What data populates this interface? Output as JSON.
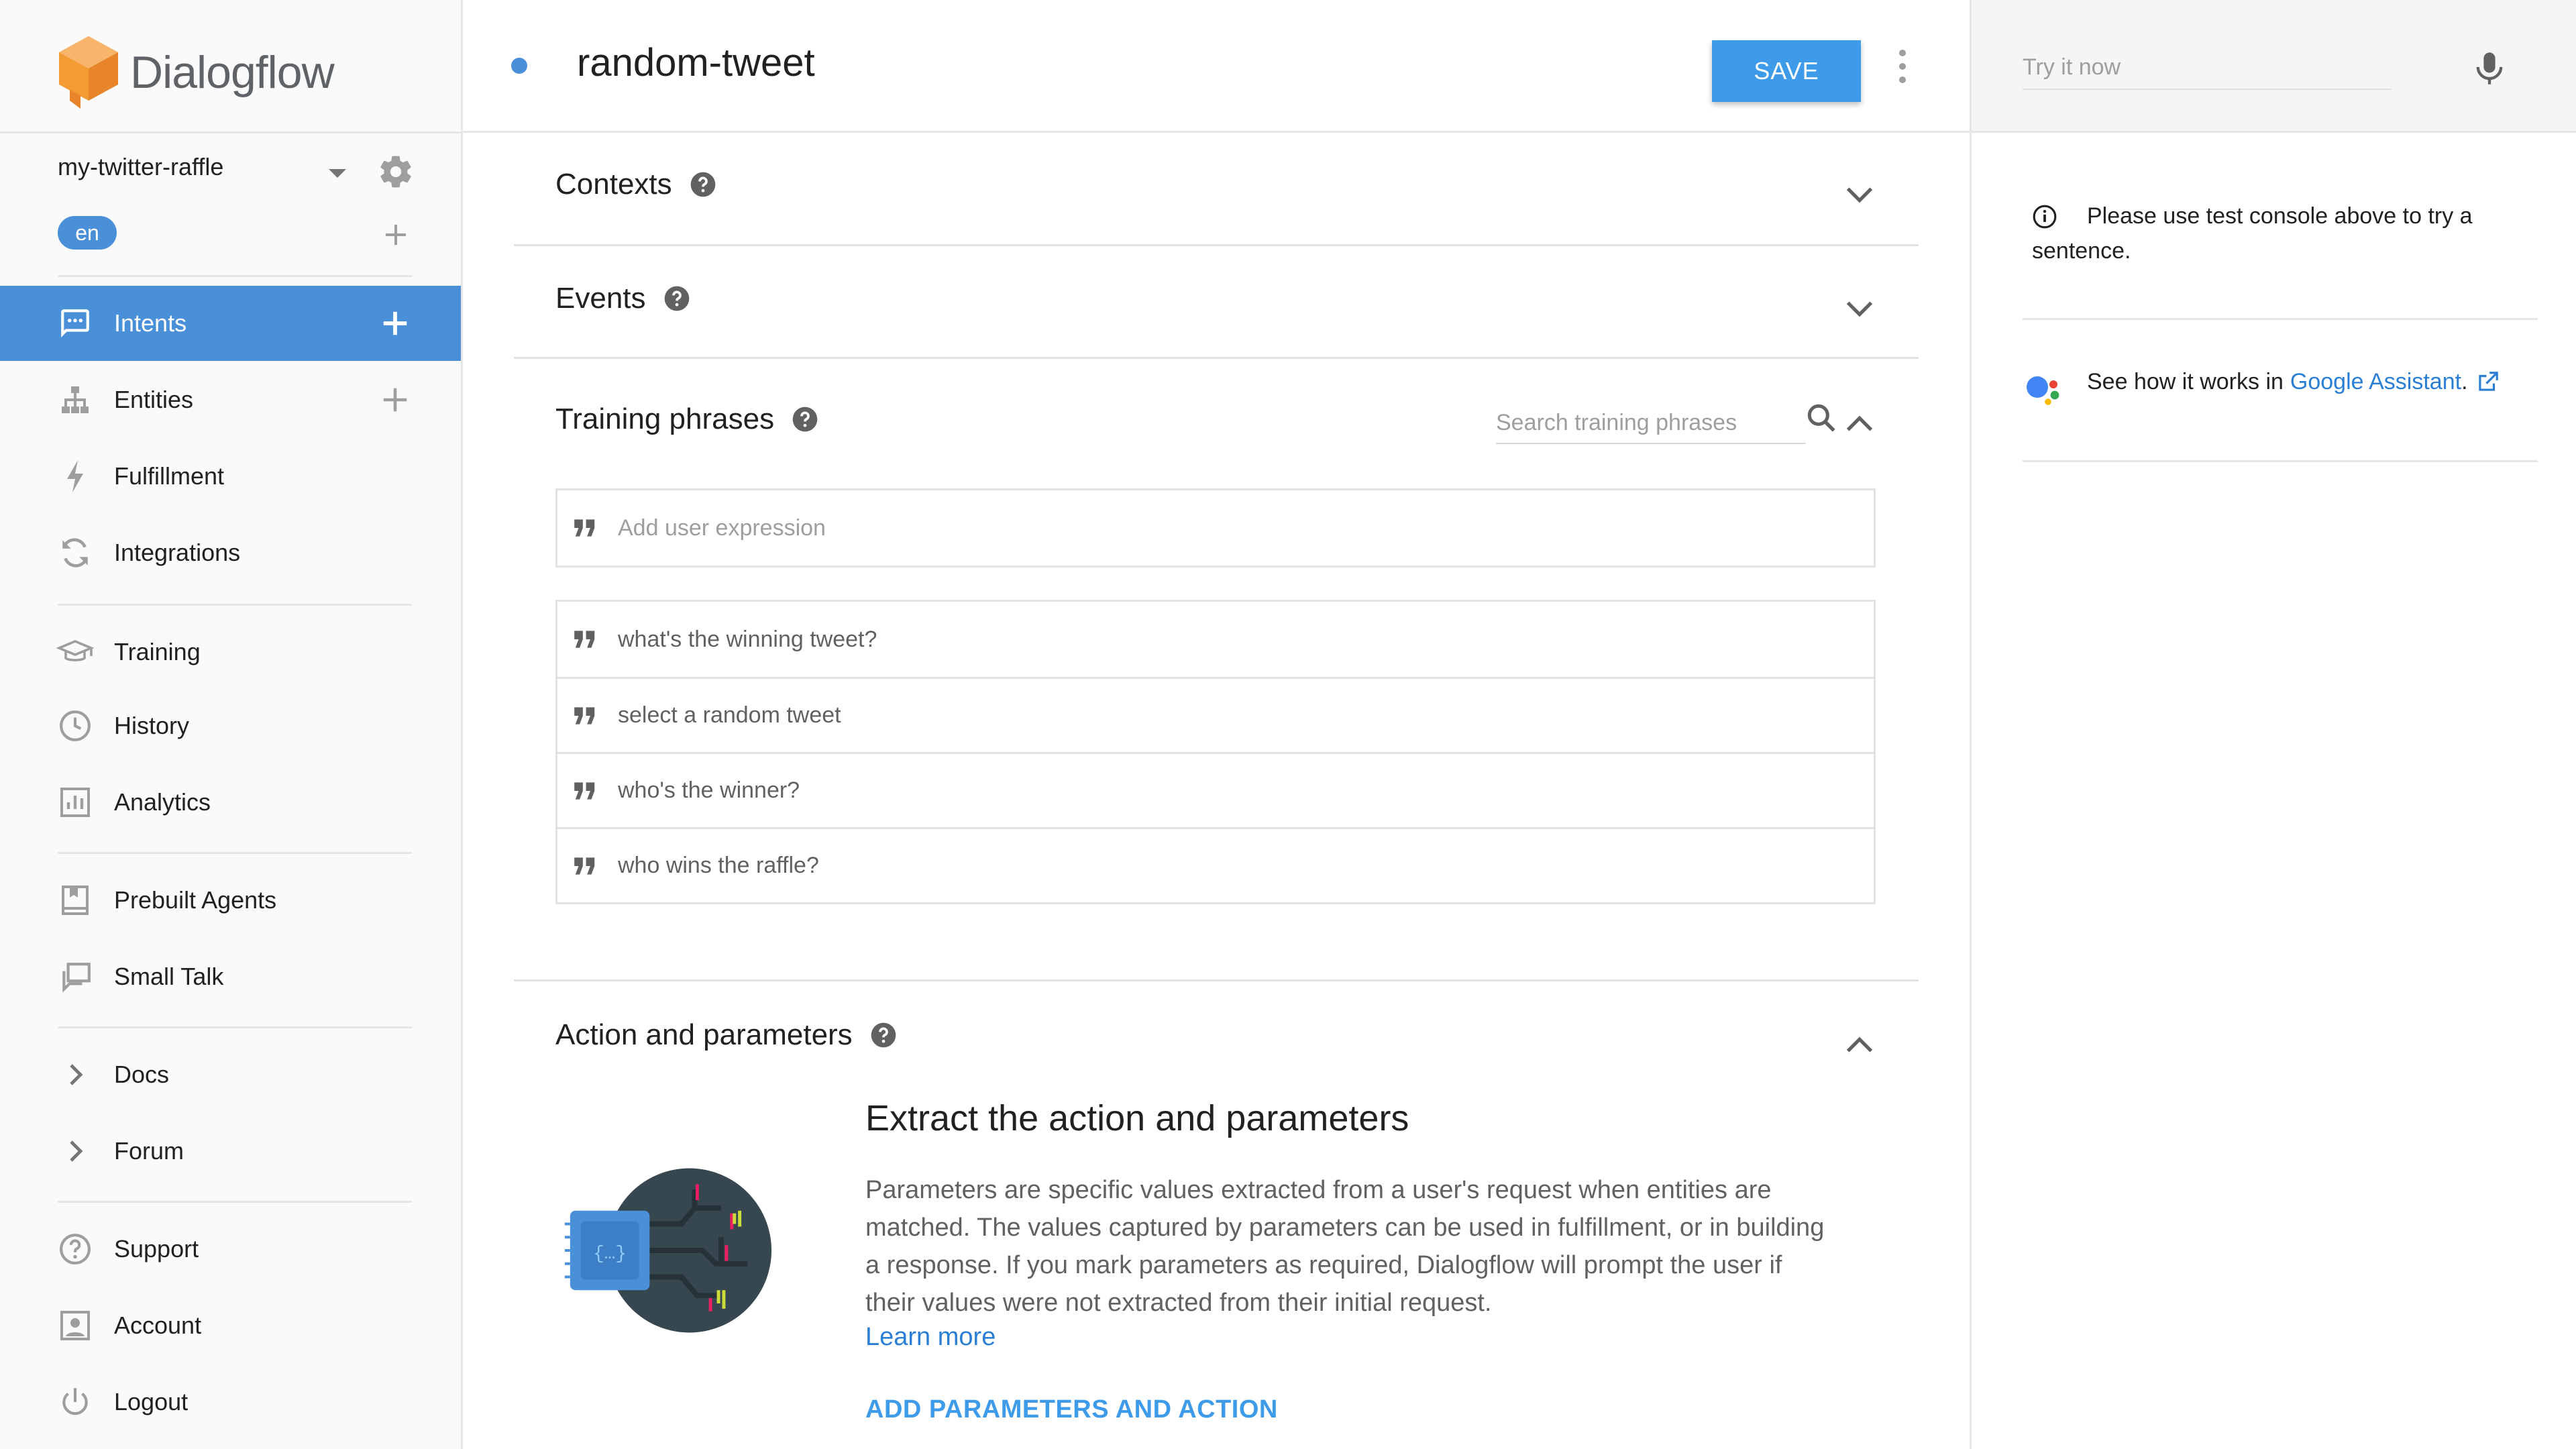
{
  "app": {
    "brand": "Dialogflow"
  },
  "agent": {
    "name": "my-twitter-raffle",
    "language": "en"
  },
  "nav": {
    "intents": "Intents",
    "entities": "Entities",
    "fulfillment": "Fulfillment",
    "integrations": "Integrations",
    "training": "Training",
    "history": "History",
    "analytics": "Analytics",
    "prebuilt_agents": "Prebuilt Agents",
    "small_talk": "Small Talk",
    "docs": "Docs",
    "forum": "Forum",
    "support": "Support",
    "account": "Account",
    "logout": "Logout"
  },
  "intent": {
    "name": "random-tweet",
    "save_label": "SAVE"
  },
  "sections": {
    "contexts": "Contexts",
    "events": "Events",
    "training_phrases": "Training phrases",
    "action_parameters": "Action and parameters"
  },
  "training": {
    "search_placeholder": "Search training phrases",
    "add_placeholder": "Add user expression",
    "phrases": [
      "what's the winning tweet?",
      "select a random tweet",
      "who's the winner?",
      "who wins the raffle?"
    ]
  },
  "action": {
    "heading": "Extract the action and parameters",
    "description": "Parameters are specific values extracted from a user's request when entities are matched. The values captured by parameters can be used in fulfillment, or in building a response. If you mark parameters as required, Dialogflow will prompt the user if their values were not extracted from their initial request.",
    "learn_more": "Learn more",
    "add_button": "ADD PARAMETERS AND ACTION"
  },
  "test_console": {
    "placeholder": "Try it now",
    "info": "Please use test console above to try a sentence.",
    "ga_prefix": "See how it works in",
    "ga_link": "Google Assistant",
    "ga_suffix": "."
  },
  "colors": {
    "accent": "#4a90d9",
    "save": "#3d9be9",
    "link": "#2a7fd4",
    "logo_orange": "#f39c34"
  },
  "icons": [
    "intents-icon",
    "entities-icon",
    "fulfillment-icon",
    "integrations-icon",
    "training-icon",
    "history-icon",
    "analytics-icon",
    "prebuilt-agents-icon",
    "small-talk-icon",
    "chevron-right-icon",
    "support-icon",
    "account-icon",
    "logout-icon",
    "gear-icon",
    "plus-icon",
    "help-icon",
    "search-icon",
    "quote-icon",
    "mic-icon",
    "info-icon",
    "google-assistant-icon",
    "external-link-icon"
  ]
}
